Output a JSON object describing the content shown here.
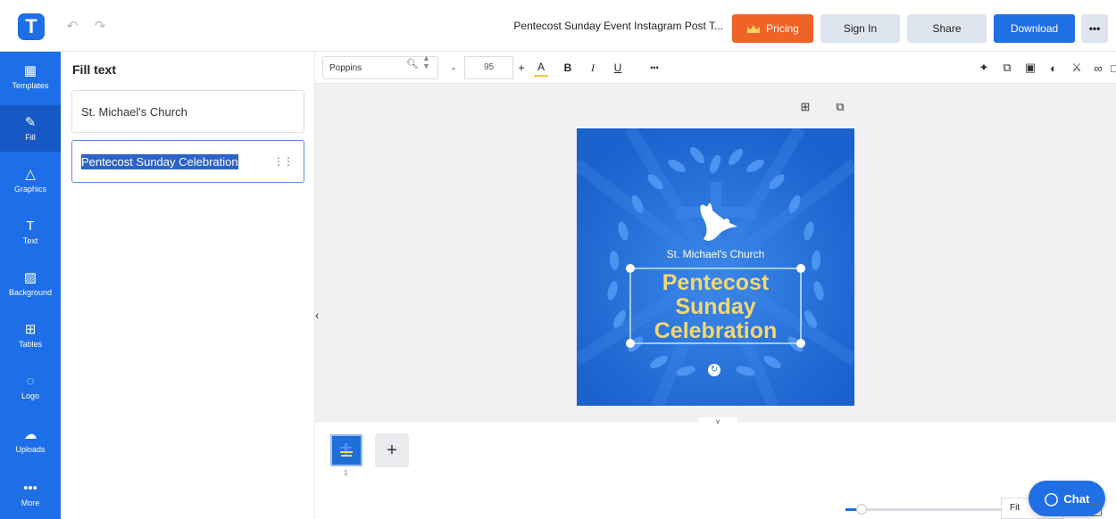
{
  "header": {
    "logo_letter": "T",
    "document_title": "Pentecost Sunday Event Instagram Post T...",
    "pricing_label": "Pricing",
    "signin_label": "Sign In",
    "share_label": "Share",
    "download_label": "Download",
    "more_label": "•••"
  },
  "sidebar": {
    "items": [
      {
        "label": "Templates",
        "icon": "templates-icon",
        "glyph": "▦"
      },
      {
        "label": "Fill",
        "icon": "pencil-icon",
        "glyph": "✎"
      },
      {
        "label": "Graphics",
        "icon": "shapes-icon",
        "glyph": "△"
      },
      {
        "label": "Text",
        "icon": "text-icon",
        "glyph": "T"
      },
      {
        "label": "Background",
        "icon": "background-icon",
        "glyph": "▨"
      },
      {
        "label": "Tables",
        "icon": "table-icon",
        "glyph": "⊞"
      },
      {
        "label": "Logo",
        "icon": "logo-icon",
        "glyph": "◌"
      },
      {
        "label": "Uploads",
        "icon": "upload-icon",
        "glyph": "☁"
      },
      {
        "label": "More",
        "icon": "more-icon",
        "glyph": "•••"
      }
    ]
  },
  "panel": {
    "title": "Fill text",
    "fields": [
      {
        "value": "St. Michael's Church"
      },
      {
        "value": "Pentecost Sunday Celebration"
      }
    ],
    "drag_handle": "⋮⋮"
  },
  "toolbar": {
    "font_name": "Poppins",
    "font_size": "95",
    "minus_label": "-",
    "plus_label": "+",
    "color_label": "A",
    "bold_label": "B",
    "italic_label": "I",
    "underline_label": "U",
    "more_label": "•••"
  },
  "canvas": {
    "church_name": "St. Michael's Church",
    "headline_lines": [
      "Pentecost",
      "Sunday",
      "Celebration"
    ],
    "colors": {
      "background": "#1f6fd9",
      "headline": "#f5d76e",
      "leaves": "#4d93ef"
    }
  },
  "pages": {
    "page_number": "1",
    "add_label": "+"
  },
  "zoom": {
    "fit_label": "Fit",
    "level_fraction": 0.1
  },
  "chat": {
    "label": "Chat"
  },
  "colors": {
    "brand_blue": "#1e6ee8",
    "pricing_orange": "#f06327"
  }
}
